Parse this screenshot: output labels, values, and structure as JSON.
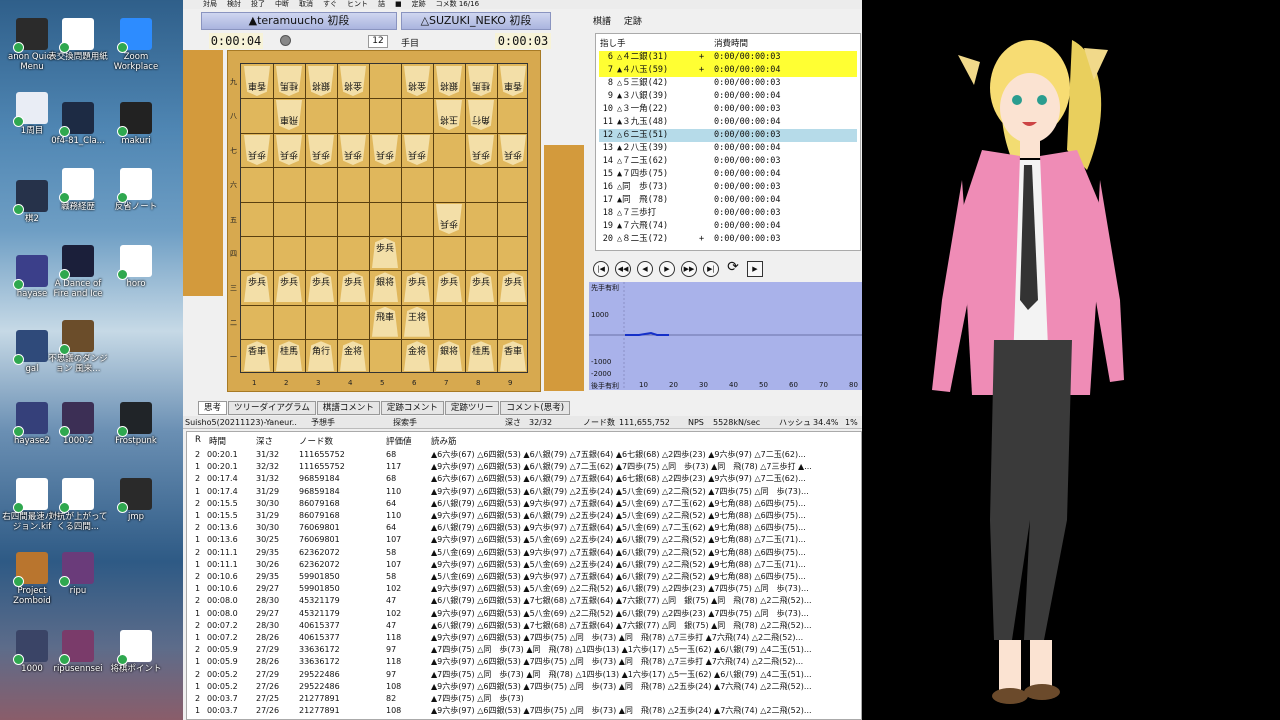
{
  "desktop": {
    "icons": [
      {
        "label": "anon Quick Menu",
        "color": "#2b2b2b"
      },
      {
        "label": "表交換問題用紙",
        "color": "#ffffff"
      },
      {
        "label": "Zoom Workplace",
        "color": "#2d8cff"
      },
      {
        "label": "1周目",
        "color": "#e9edf5"
      },
      {
        "label": "0f4-81_Cla...",
        "color": "#1d2b44"
      },
      {
        "label": "makuri",
        "color": "#222222"
      },
      {
        "label": "棋2",
        "color": "#26324a"
      },
      {
        "label": "職務経歴",
        "color": "#ffffff"
      },
      {
        "label": "反省ノート",
        "color": "#ffffff"
      },
      {
        "label": "hayase",
        "color": "#3b3f8a"
      },
      {
        "label": "A Dance of Fire and Ice",
        "color": "#1b1f3a"
      },
      {
        "label": "horo",
        "color": "#ffffff"
      },
      {
        "label": "gal",
        "color": "#2f4a7a"
      },
      {
        "label": "不思議のダンジョン 風来...",
        "color": "#6b4d2a"
      },
      {
        "label": "hayase2",
        "color": "#35407a"
      },
      {
        "label": "1000-2",
        "color": "#3c2f55"
      },
      {
        "label": "Frostpunk",
        "color": "#202428"
      },
      {
        "label": "右四間最速バージョン.kif",
        "color": "#ffffff"
      },
      {
        "label": "対抗が上がってくる四間...",
        "color": "#ffffff"
      },
      {
        "label": "jmp",
        "color": "#2a2a2a"
      },
      {
        "label": "Project Zomboid",
        "color": "#b9752e"
      },
      {
        "label": "ripu",
        "color": "#6a3b7a"
      },
      {
        "label": "1000",
        "color": "#3a4466"
      },
      {
        "label": "ripusennsei",
        "color": "#7a3b6a"
      },
      {
        "label": "将棋ポイント",
        "color": "#ffffff"
      }
    ]
  },
  "toolbar": [
    "対局",
    "検討",
    "投了",
    "中断",
    "取消",
    "すぐ",
    "ヒント",
    "詰",
    "■",
    "定跡",
    "コメ数 16/16"
  ],
  "players": {
    "black": "▲teramuucho 初段",
    "white": "△SUZUKI_NEKO 初段",
    "black_time": "0:00:04",
    "white_time": "0:00:03",
    "move_no": "12",
    "move_suffix": "手目"
  },
  "board": {
    "rows": [
      [
        "香車",
        "桂馬",
        "銀将",
        "金将",
        "",
        "金将",
        "銀将",
        "桂馬",
        "香車"
      ],
      [
        "",
        "飛車",
        "",
        "",
        "",
        "",
        "玉将",
        "角行",
        ""
      ],
      [
        "歩兵",
        "歩兵",
        "歩兵",
        "歩兵",
        "歩兵",
        "歩兵",
        "",
        "歩兵",
        "歩兵"
      ],
      [
        "",
        "",
        "",
        "",
        "",
        "",
        "",
        "",
        ""
      ],
      [
        "",
        "",
        "",
        "",
        "",
        "",
        "歩兵",
        "",
        ""
      ],
      [
        "",
        "",
        "",
        "",
        "歩兵",
        "",
        "",
        "",
        ""
      ],
      [
        "歩兵",
        "歩兵",
        "歩兵",
        "歩兵",
        "銀将",
        "歩兵",
        "歩兵",
        "歩兵",
        "歩兵"
      ],
      [
        "",
        "",
        "",
        "",
        "飛車",
        "王将",
        "",
        "",
        ""
      ],
      [
        "香車",
        "桂馬",
        "角行",
        "金将",
        "",
        "金将",
        "銀将",
        "桂馬",
        "香車"
      ]
    ],
    "files": [
      "1",
      "2",
      "3",
      "4",
      "5",
      "6",
      "7",
      "8",
      "9"
    ],
    "ranks": [
      "九",
      "八",
      "七",
      "六",
      "五",
      "四",
      "三",
      "二",
      "一"
    ]
  },
  "kifu": {
    "tabs": [
      "棋譜",
      "定跡"
    ],
    "header_move": "指し手",
    "header_time": "消費時間",
    "rows": [
      {
        "n": "6",
        "m": "△４二銀(31)",
        "t": "0:00/00:00:03",
        "hl": "y",
        "plus": "+"
      },
      {
        "n": "7",
        "m": "▲４八玉(59)",
        "t": "0:00/00:00:04",
        "hl": "y",
        "plus": "+"
      },
      {
        "n": "8",
        "m": "△５三銀(42)",
        "t": "0:00/00:00:03",
        "hl": "",
        "plus": ""
      },
      {
        "n": "9",
        "m": "▲３八銀(39)",
        "t": "0:00/00:00:04",
        "hl": "",
        "plus": ""
      },
      {
        "n": "10",
        "m": "△３一角(22)",
        "t": "0:00/00:00:03",
        "hl": "",
        "plus": ""
      },
      {
        "n": "11",
        "m": "▲３九玉(48)",
        "t": "0:00/00:00:04",
        "hl": "",
        "plus": ""
      },
      {
        "n": "12",
        "m": "△６二玉(51)",
        "t": "0:00/00:00:03",
        "hl": "b",
        "plus": ""
      },
      {
        "n": "13",
        "m": "▲２八玉(39)",
        "t": "0:00/00:00:04",
        "hl": "",
        "plus": ""
      },
      {
        "n": "14",
        "m": "△７二玉(62)",
        "t": "0:00/00:00:03",
        "hl": "",
        "plus": ""
      },
      {
        "n": "15",
        "m": "▲７四歩(75)",
        "t": "0:00/00:00:04",
        "hl": "",
        "plus": ""
      },
      {
        "n": "16",
        "m": "△同　歩(73)",
        "t": "0:00/00:00:03",
        "hl": "",
        "plus": ""
      },
      {
        "n": "17",
        "m": "▲同　飛(78)",
        "t": "0:00/00:00:04",
        "hl": "",
        "plus": ""
      },
      {
        "n": "18",
        "m": "△７三歩打",
        "t": "0:00/00:00:03",
        "hl": "",
        "plus": ""
      },
      {
        "n": "19",
        "m": "▲７六飛(74)",
        "t": "0:00/00:00:04",
        "hl": "",
        "plus": ""
      },
      {
        "n": "20",
        "m": "△８二玉(72)",
        "t": "0:00/00:00:03",
        "hl": "",
        "plus": "+"
      }
    ]
  },
  "graph": {
    "labels": [
      "先手有利",
      "1000",
      "-1000",
      "-2000",
      "後手有利"
    ],
    "x": [
      "10",
      "20",
      "30",
      "40",
      "50",
      "60",
      "70",
      "80"
    ]
  },
  "tabs": [
    "思考",
    "ツリーダイアグラム",
    "棋譜コメント",
    "定跡コメント",
    "定跡ツリー",
    "コメント(思考)"
  ],
  "status": {
    "engine": "Suisho5(20211123)-Yaneur...",
    "pred": "予想手",
    "search": "探索手",
    "depth_label": "深さ",
    "depth": "32/32",
    "nodes_label": "ノード数",
    "nodes": "111,655,752",
    "nps_label": "NPS",
    "nps": "5528kN/sec",
    "hash_label": "ハッシュ",
    "hash": "34.4%",
    "ent": "1%"
  },
  "think": {
    "headers": [
      "R",
      "時間",
      "深さ",
      "ノード数",
      "評価値",
      "読み筋"
    ],
    "rows": [
      [
        "2",
        "00:20.1",
        "31/32",
        "111655752",
        "68",
        "▲6六歩(67) △6四銀(53) ▲6八銀(79) △7五銀(64) ▲6七銀(68) △2四歩(23) ▲9六歩(97) △7二玉(62)..."
      ],
      [
        "1",
        "00:20.1",
        "32/32",
        "111655752",
        "117",
        "▲9六歩(97) △6四銀(53) ▲6八銀(79) △7二玉(62) ▲7四歩(75) △同　歩(73) ▲同　飛(78) △7三歩打 ▲..."
      ],
      [
        "2",
        "00:17.4",
        "31/32",
        "96859184",
        "68",
        "▲6六歩(67) △6四銀(53) ▲6八銀(79) △7五銀(64) ▲6七銀(68) △2四歩(23) ▲9六歩(97) △7二玉(62)..."
      ],
      [
        "1",
        "00:17.4",
        "31/29",
        "96859184",
        "110",
        "▲9六歩(97) △6四銀(53) ▲6八銀(79) △2五歩(24) ▲5八金(69) △2二飛(52) ▲7四歩(75) △同　歩(73)..."
      ],
      [
        "2",
        "00:15.5",
        "30/30",
        "86079168",
        "64",
        "▲6八銀(79) △6四銀(53) ▲9六歩(97) △7五銀(64) ▲5八金(69) △7二玉(62) ▲9七角(88) △6四歩(75)..."
      ],
      [
        "1",
        "00:15.5",
        "31/29",
        "86079168",
        "110",
        "▲9六歩(97) △6四銀(53) ▲6八銀(79) △2五歩(24) ▲5八金(69) △2二飛(52) ▲9七角(88) △6四歩(75)..."
      ],
      [
        "2",
        "00:13.6",
        "30/30",
        "76069801",
        "64",
        "▲6八銀(79) △6四銀(53) ▲9六歩(97) △7五銀(64) ▲5八金(69) △7二玉(62) ▲9七角(88) △6四歩(75)..."
      ],
      [
        "1",
        "00:13.6",
        "30/25",
        "76069801",
        "107",
        "▲9六歩(97) △6四銀(53) ▲5八金(69) △2五歩(24) ▲6八銀(79) △2二飛(52) ▲9七角(88) △7二玉(71)..."
      ],
      [
        "2",
        "00:11.1",
        "29/35",
        "62362072",
        "58",
        "▲5八金(69) △6四銀(53) ▲9六歩(97) △7五銀(64) ▲6八銀(79) △2二飛(52) ▲9七角(88) △6四歩(75)..."
      ],
      [
        "1",
        "00:11.1",
        "30/26",
        "62362072",
        "107",
        "▲9六歩(97) △6四銀(53) ▲5八金(69) △2五歩(24) ▲6八銀(79) △2二飛(52) ▲9七角(88) △7二玉(71)..."
      ],
      [
        "2",
        "00:10.6",
        "29/35",
        "59901850",
        "58",
        "▲5八金(69) △6四銀(53) ▲9六歩(97) △7五銀(64) ▲6八銀(79) △2二飛(52) ▲9七角(88) △6四歩(75)..."
      ],
      [
        "1",
        "00:10.6",
        "29/27",
        "59901850",
        "102",
        "▲9六歩(97) △6四銀(53) ▲5八金(69) △2二飛(52) ▲6八銀(79) △2四歩(23) ▲7四歩(75) △同　歩(73)..."
      ],
      [
        "2",
        "00:08.0",
        "28/30",
        "45321179",
        "47",
        "▲6八銀(79) △6四銀(53) ▲7七銀(68) △7五銀(64) ▲7六銀(77) △同　銀(75) ▲同　飛(78) △2二飛(52)..."
      ],
      [
        "1",
        "00:08.0",
        "29/27",
        "45321179",
        "102",
        "▲9六歩(97) △6四銀(53) ▲5八金(69) △2二飛(52) ▲6八銀(79) △2四歩(23) ▲7四歩(75) △同　歩(73)..."
      ],
      [
        "2",
        "00:07.2",
        "28/30",
        "40615377",
        "47",
        "▲6八銀(79) △6四銀(53) ▲7七銀(68) △7五銀(64) ▲7六銀(77) △同　銀(75) ▲同　飛(78) △2二飛(52)..."
      ],
      [
        "1",
        "00:07.2",
        "28/26",
        "40615377",
        "118",
        "▲9六歩(97) △6四銀(53) ▲7四歩(75) △同　歩(73) ▲同　飛(78) △7三歩打 ▲7六飛(74) △2二飛(52)..."
      ],
      [
        "2",
        "00:05.9",
        "27/29",
        "33636172",
        "97",
        "▲7四歩(75) △同　歩(73) ▲同　飛(78) △1四歩(13) ▲1六歩(17) △5一玉(62) ▲6八銀(79) △4二玉(51)..."
      ],
      [
        "1",
        "00:05.9",
        "28/26",
        "33636172",
        "118",
        "▲9六歩(97) △6四銀(53) ▲7四歩(75) △同　歩(73) ▲同　飛(78) △7三歩打 ▲7六飛(74) △2二飛(52)..."
      ],
      [
        "2",
        "00:05.2",
        "27/29",
        "29522486",
        "97",
        "▲7四歩(75) △同　歩(73) ▲同　飛(78) △1四歩(13) ▲1六歩(17) △5一玉(62) ▲6八銀(79) △4二玉(51)..."
      ],
      [
        "1",
        "00:05.2",
        "27/26",
        "29522486",
        "108",
        "▲9六歩(97) △6四銀(53) ▲7四歩(75) △同　歩(73) ▲同　飛(78) △2五歩(24) ▲7六飛(74) △2二飛(52)..."
      ],
      [
        "2",
        "00:03.7",
        "27/25",
        "21277891",
        "82",
        "▲7四歩(75) △同　歩(73)"
      ],
      [
        "1",
        "00:03.7",
        "27/26",
        "21277891",
        "108",
        "▲9六歩(97) △6四銀(53) ▲7四歩(75) △同　歩(73) ▲同　飛(78) △2五歩(24) ▲7六飛(74) △2二飛(52)..."
      ]
    ]
  }
}
